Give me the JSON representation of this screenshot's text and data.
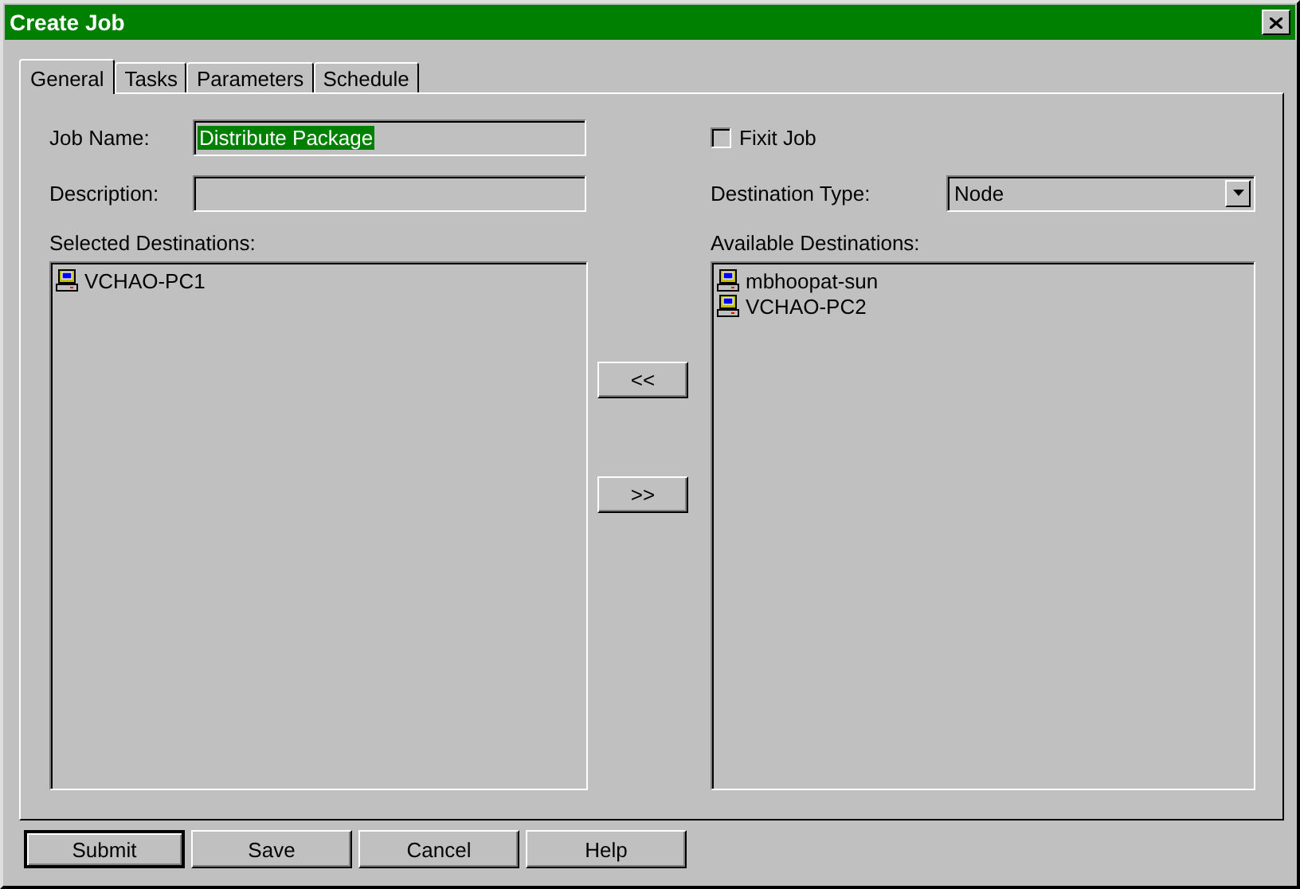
{
  "window": {
    "title": "Create Job"
  },
  "tabs": [
    {
      "label": "General",
      "selected": true
    },
    {
      "label": "Tasks",
      "selected": false
    },
    {
      "label": "Parameters",
      "selected": false
    },
    {
      "label": "Schedule",
      "selected": false
    }
  ],
  "job_name": {
    "label": "Job Name:",
    "value": "Distribute Package"
  },
  "description": {
    "label": "Description:"
  },
  "fixit_job": {
    "label": "Fixit Job",
    "checked": false
  },
  "destination_type": {
    "label": "Destination Type:",
    "value": "Node"
  },
  "selected_destinations": {
    "label": "Selected Destinations:",
    "items": [
      {
        "name": "VCHAO-PC1"
      }
    ]
  },
  "available_destinations": {
    "label": "Available Destinations:",
    "items": [
      {
        "name": "mbhoopat-sun"
      },
      {
        "name": "VCHAO-PC2"
      }
    ]
  },
  "move_buttons": [
    "<<",
    ">>"
  ],
  "buttons": [
    {
      "label": "Submit",
      "default": true
    },
    {
      "label": "Save",
      "default": false
    },
    {
      "label": "Cancel",
      "default": false
    },
    {
      "label": "Help",
      "default": false
    }
  ]
}
